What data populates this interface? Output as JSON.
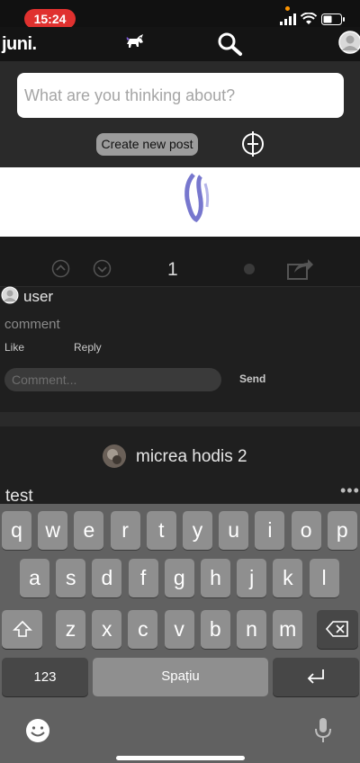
{
  "status": {
    "time": "15:24"
  },
  "header": {
    "brand": "juni."
  },
  "composer": {
    "placeholder": "What are you thinking about?",
    "create_label": "Create new post"
  },
  "post": {
    "vote_count": "1"
  },
  "comment": {
    "username": "user",
    "text": "comment",
    "like_label": "Like",
    "reply_label": "Reply",
    "input_placeholder": "Comment...",
    "send_label": "Send"
  },
  "next_post": {
    "author": "micrea hodis 2",
    "title": "test"
  },
  "keyboard": {
    "row1": [
      "q",
      "w",
      "e",
      "r",
      "t",
      "y",
      "u",
      "i",
      "o",
      "p"
    ],
    "row2": [
      "a",
      "s",
      "d",
      "f",
      "g",
      "h",
      "j",
      "k",
      "l"
    ],
    "row3": [
      "z",
      "x",
      "c",
      "v",
      "b",
      "n",
      "m"
    ],
    "numbers_label": "123",
    "space_label": "Spațiu"
  },
  "colors": {
    "accent_red": "#e0312f",
    "vote_blue": "#8f9fd4"
  }
}
